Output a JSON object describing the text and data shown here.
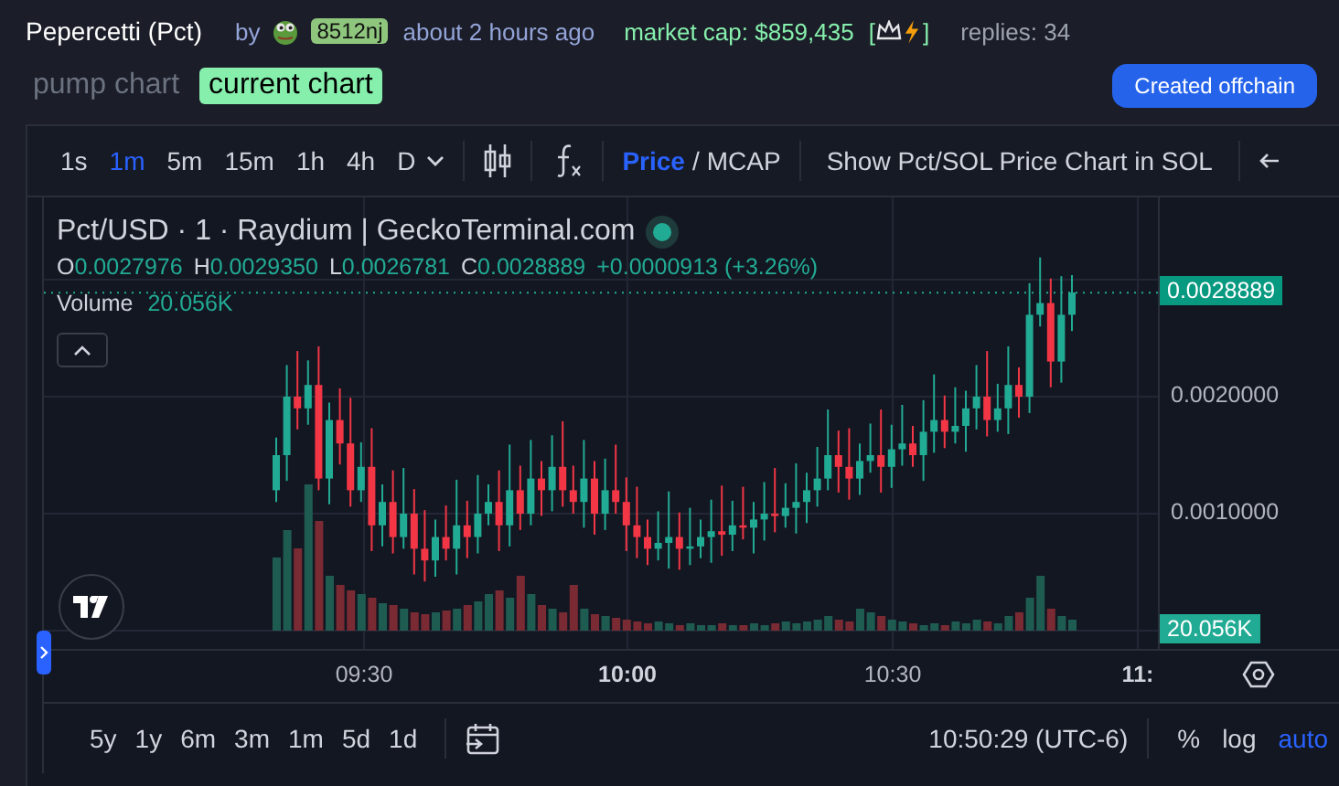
{
  "header": {
    "title": "Pepercetti (Pct)",
    "by": "by",
    "creator": "8512nj",
    "time": "about 2 hours ago",
    "market_cap": "market cap: $859,435",
    "bracket_open": "[",
    "bracket_close": "]",
    "replies": "replies: 34"
  },
  "chart_tabs": [
    {
      "label": "pump chart",
      "selected": false
    },
    {
      "label": "current chart",
      "selected": true
    }
  ],
  "offchain_button": "Created offchain",
  "toolbar": {
    "intervals": [
      {
        "label": "1s",
        "selected": false
      },
      {
        "label": "1m",
        "selected": true
      },
      {
        "label": "5m",
        "selected": false
      },
      {
        "label": "15m",
        "selected": false
      },
      {
        "label": "1h",
        "selected": false
      },
      {
        "label": "4h",
        "selected": false
      },
      {
        "label": "D",
        "selected": false
      }
    ],
    "price_label": "Price",
    "separator": "/",
    "mcap_label": "MCAP",
    "price_selected": true,
    "sol_button": "Show Pct/SOL Price Chart in SOL"
  },
  "legend": {
    "title": "Pct/USD · 1 · Raydium | GeckoTerminal.com",
    "ohlc": [
      {
        "key": "O",
        "value": "0.0027976"
      },
      {
        "key": "H",
        "value": "0.0029350"
      },
      {
        "key": "L",
        "value": "0.0026781"
      },
      {
        "key": "C",
        "value": "0.0028889"
      }
    ],
    "change": "+0.0000913 (+3.26%)",
    "volume_label": "Volume",
    "volume_value": "20.056K"
  },
  "price_axis": {
    "ticks": [
      "0.0020000",
      "0.0010000"
    ],
    "last_price": "0.0028889",
    "last_volume": "20.056K"
  },
  "time_axis": [
    {
      "label": "09:30",
      "bold": false
    },
    {
      "label": "10:00",
      "bold": true
    },
    {
      "label": "10:30",
      "bold": false
    },
    {
      "label": "11:",
      "bold": true
    }
  ],
  "ranges": [
    "5y",
    "1y",
    "6m",
    "3m",
    "1m",
    "5d",
    "1d"
  ],
  "clock": "10:50:29 (UTC-6)",
  "scale_options": [
    {
      "label": "%",
      "selected": false
    },
    {
      "label": "log",
      "selected": false
    },
    {
      "label": "auto",
      "selected": true
    }
  ]
}
